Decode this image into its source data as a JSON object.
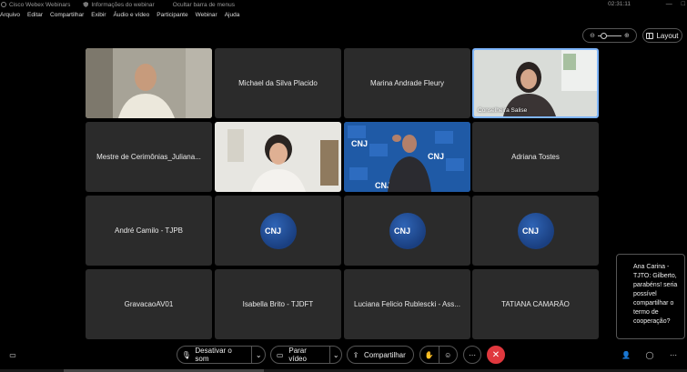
{
  "titlebar": {
    "app_title": "Cisco Webex Webinars",
    "info_label": "Informações do webinar",
    "hide_menu_label": "Ocultar barra de menus",
    "time": "02:31:11"
  },
  "menu": [
    "Arquivo",
    "Editar",
    "Compartilhar",
    "Exibir",
    "Áudio e vídeo",
    "Participante",
    "Webinar",
    "Ajuda"
  ],
  "view": {
    "layout_label": "Layout",
    "zoom_level": 0.15
  },
  "tiles": [
    {
      "name": "",
      "kind": "video"
    },
    {
      "name": "Michael da Silva Placido",
      "kind": "name"
    },
    {
      "name": "Marina Andrade Fleury",
      "kind": "name"
    },
    {
      "name": "Conselheira Salise",
      "kind": "video",
      "active": true
    },
    {
      "name": "Mestre de Cerimônias_Juliana...",
      "kind": "name"
    },
    {
      "name": "",
      "kind": "video"
    },
    {
      "name": "",
      "kind": "video"
    },
    {
      "name": "Adriana Tostes",
      "kind": "name"
    },
    {
      "name": "André Camilo - TJPB",
      "kind": "name"
    },
    {
      "name": "",
      "kind": "logo"
    },
    {
      "name": "",
      "kind": "logo"
    },
    {
      "name": "",
      "kind": "logo"
    },
    {
      "name": "GravacaoAV01",
      "kind": "name"
    },
    {
      "name": "Isabella Brito - TJDFT",
      "kind": "name"
    },
    {
      "name": "Luciana Felicio Rublescki - Ass...",
      "kind": "name"
    },
    {
      "name": "TATIANA CAMARÃO",
      "kind": "name"
    }
  ],
  "logo_text": "CNJ",
  "chat": {
    "text": "Ana Carina - TJTO: Gilberto, parabéns! seria possível compartilhar o termo de cooperação?"
  },
  "toolbar": {
    "mute_label": "Desativar o som",
    "video_label": "Parar vídeo",
    "share_label": "Compartilhar"
  },
  "colors": {
    "end_button": "#e0383e",
    "active_border": "#7fb6ff",
    "tile_bg": "#2b2b2b",
    "logo_blue": "#1f4a94"
  }
}
